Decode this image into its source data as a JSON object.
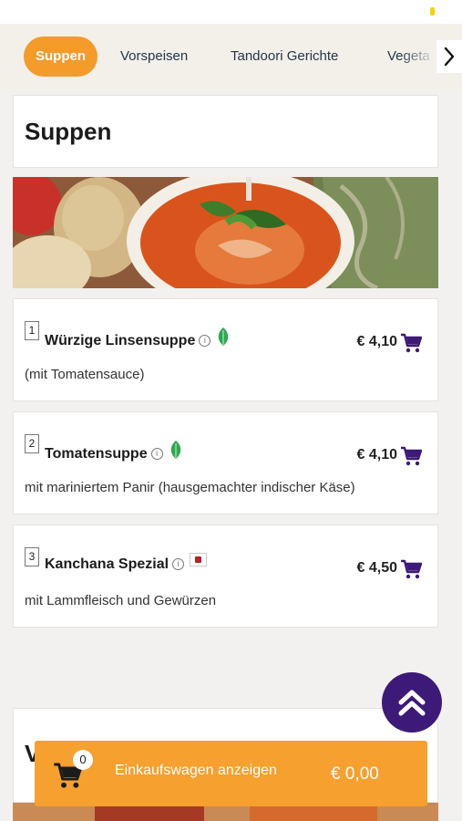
{
  "tabs": [
    {
      "label": "Suppen",
      "active": true
    },
    {
      "label": "Vorspeisen",
      "active": false
    },
    {
      "label": "Tandoori Gerichte",
      "active": false
    },
    {
      "label": "Vegeta",
      "active": false
    }
  ],
  "section": {
    "title": "Suppen",
    "next_title": "V"
  },
  "currency_note": "",
  "items": [
    {
      "number": "1",
      "name": "Würzige Linsensuppe",
      "badge": "leaf-icon",
      "description": "(mit Tomatensauce)",
      "price": "€ 4,10"
    },
    {
      "number": "2",
      "name": "Tomatensuppe",
      "badge": "leaf-icon",
      "description": "mit mariniertem Panir (hausgemachter indischer Käse)",
      "price": "€ 4,10"
    },
    {
      "number": "3",
      "name": "Kanchana Spezial",
      "badge": "flag-icon",
      "description": "mit Lammfleisch und Gewürzen",
      "price": "€ 4,50"
    }
  ],
  "info_glyph": "i",
  "cart": {
    "count": "0",
    "label": "Einkaufswagen anzeigen",
    "total": "€ 0,00"
  },
  "colors": {
    "accent": "#f49b2a",
    "purple": "#3d1a78",
    "leaf": "#2ea84f"
  }
}
